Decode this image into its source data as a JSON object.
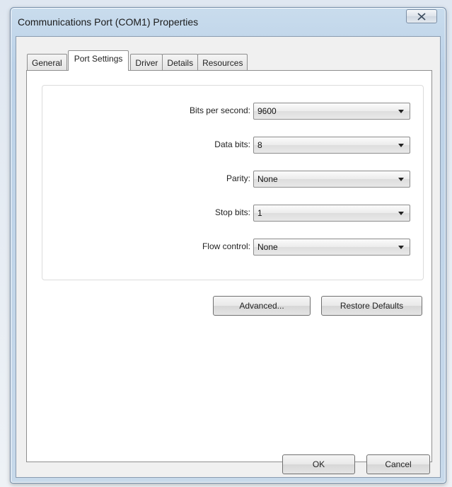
{
  "window": {
    "title": "Communications Port (COM1) Properties"
  },
  "tabs": [
    {
      "label": "General",
      "active": false
    },
    {
      "label": "Port Settings",
      "active": true
    },
    {
      "label": "Driver",
      "active": false
    },
    {
      "label": "Details",
      "active": false
    },
    {
      "label": "Resources",
      "active": false
    }
  ],
  "settings": {
    "bits_per_second": {
      "label": "Bits per second:",
      "value": "9600"
    },
    "data_bits": {
      "label": "Data bits:",
      "value": "8"
    },
    "parity": {
      "label": "Parity:",
      "value": "None"
    },
    "stop_bits": {
      "label": "Stop bits:",
      "value": "1"
    },
    "flow_control": {
      "label": "Flow control:",
      "value": "None"
    }
  },
  "buttons": {
    "advanced": "Advanced...",
    "restore_defaults": "Restore Defaults",
    "ok": "OK",
    "cancel": "Cancel"
  },
  "icons": {
    "close": "close-icon",
    "dropdown": "chevron-down-icon"
  }
}
